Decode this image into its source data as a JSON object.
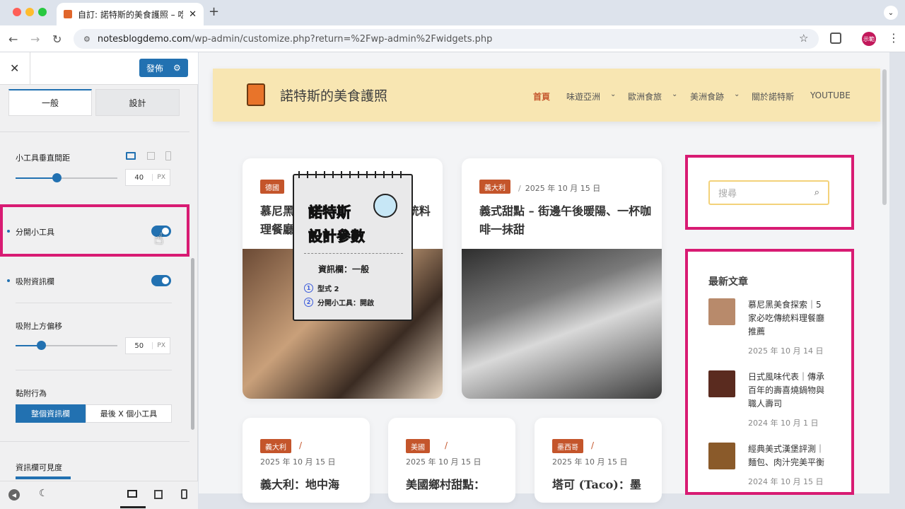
{
  "browser": {
    "tab_title": "自訂: 諾特斯的美食護照 – 吃遍",
    "url_host": "notesblogdemo.com",
    "url_path": "/wp-admin/customize.php?return=%2Fwp-admin%2Fwidgets.php",
    "profile": "示範"
  },
  "customizer": {
    "publish_label": "發佈",
    "tabs": [
      "一般",
      "設計"
    ],
    "widget_spacing_label": "小工具垂直間距",
    "widget_spacing_value": "40",
    "widget_spacing_fraction": 0.4,
    "unit": "PX",
    "separate_widgets_label": "分開小工具",
    "sticky_sidebar_label": "吸附資訊欄",
    "top_offset_label": "吸附上方偏移",
    "top_offset_value": "50",
    "top_offset_fraction": 0.25,
    "sticky_behavior_label": "黏附行為",
    "sticky_options": [
      "整個資訊欄",
      "最後 X 個小工具"
    ],
    "visibility_label": "資訊欄可見度"
  },
  "overlay": {
    "title_line1": "諾特斯",
    "title_line2": "設計參數",
    "section": "資訊欄：一般",
    "items": [
      {
        "num": "1",
        "text": "型式 2"
      },
      {
        "num": "2",
        "text": "分開小工具：開啟"
      }
    ]
  },
  "site": {
    "brand": "諾特斯的美食護照",
    "menu": [
      {
        "label": "首頁",
        "active": true,
        "caret": false
      },
      {
        "label": "味遊亞洲",
        "caret": true
      },
      {
        "label": "歐洲食旅",
        "caret": true
      },
      {
        "label": "美洲食跡",
        "caret": true
      },
      {
        "label": "關於諾特斯",
        "caret": false
      },
      {
        "label": "YOUTUBE",
        "caret": false
      }
    ],
    "cards": [
      {
        "tag": "德國",
        "title": "慕尼黑美食探索｜5 家必吃傳統料理餐廳推薦"
      },
      {
        "tag": "義大利",
        "date": "2025 年 10 月 15 日",
        "title": "義式甜點 – 街邊午後暖陽、一杯咖啡一抹甜"
      }
    ],
    "small_cards": [
      {
        "tag": "義大利",
        "date": "2025 年 10 月 15 日",
        "title": "義大利：地中海"
      },
      {
        "tag": "美國",
        "date": "2025 年 10 月 15 日",
        "title": "美國鄉村甜點："
      },
      {
        "tag": "墨西哥",
        "date": "2025 年 10 月 15 日",
        "title": "塔可 (Taco)：墨"
      }
    ],
    "search_placeholder": "搜尋",
    "recent_title": "最新文章",
    "recent": [
      {
        "title": "慕尼黑美食探索｜5 家必吃傳統料理餐廳推薦",
        "date": "2025 年 10 月 14 日"
      },
      {
        "title": "日式風味代表｜傳承百年的壽喜燒鍋物與職人壽司",
        "date": "2024 年 10 月 1 日"
      },
      {
        "title": "經典美式漢堡評測｜麵包、肉汁完美平衡",
        "date": "2024 年 10 月 15 日"
      }
    ]
  },
  "colors": {
    "accent": "#2271b1",
    "highlight": "#d81b73",
    "brand_bg": "#f8e6b2",
    "tag": "#c4552b"
  }
}
